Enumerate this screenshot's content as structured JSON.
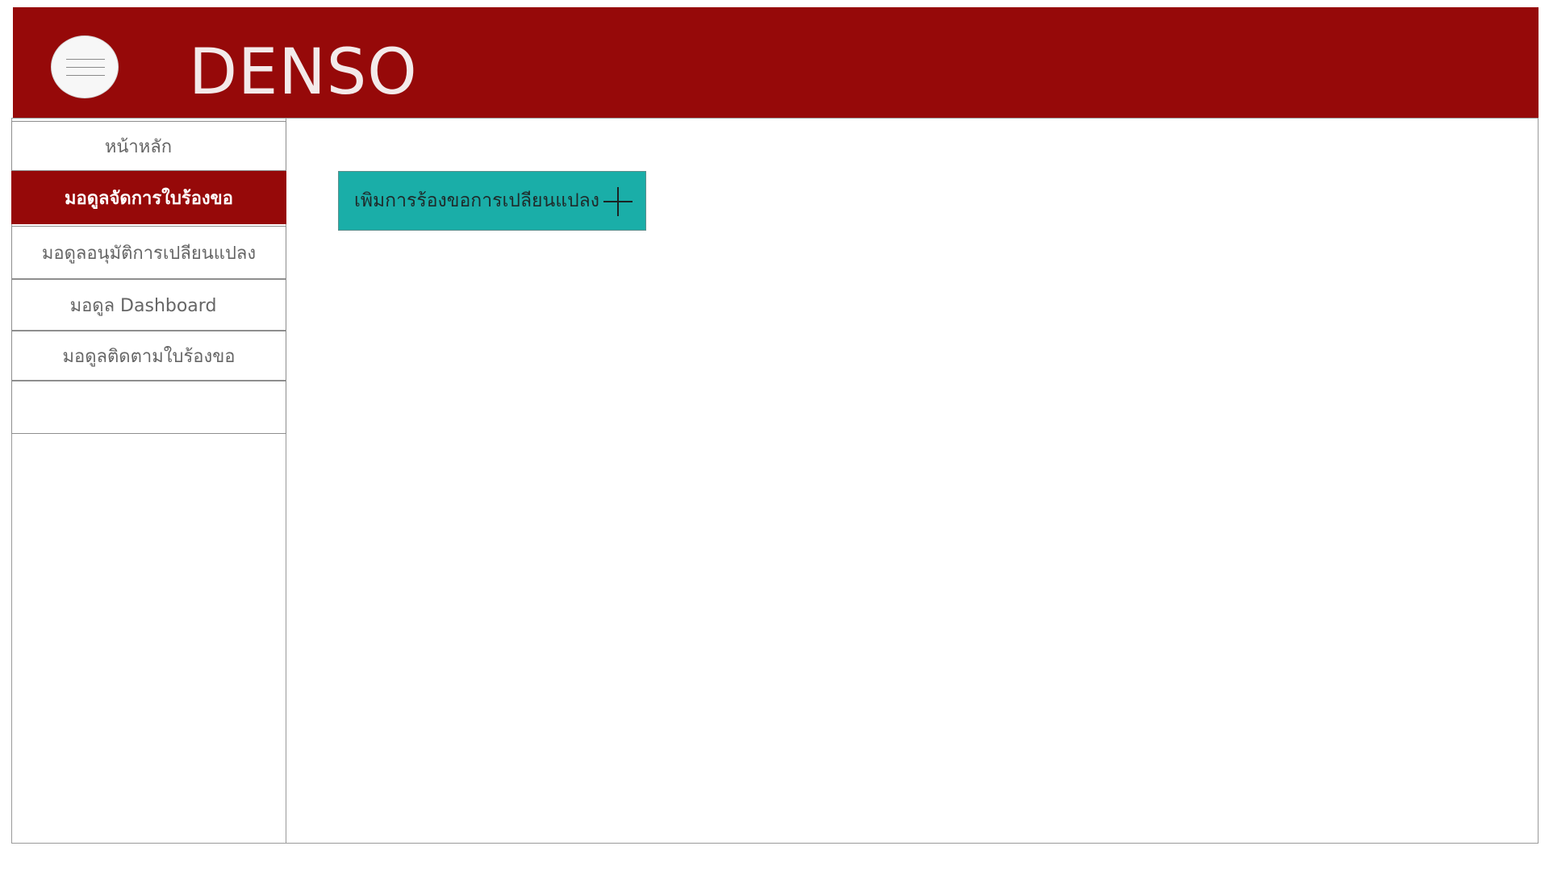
{
  "header": {
    "brand": "DENSO",
    "menu_icon": "hamburger-menu-icon",
    "background_color": "#960909"
  },
  "sidebar": {
    "items": [
      {
        "label": "หน้าหลัก",
        "active": false
      },
      {
        "label": "มอดูลจัดการใบร้องขอ",
        "active": true
      },
      {
        "label": "มอดูลอนุมัติการเปลียนแปลง",
        "active": false
      },
      {
        "label": "มอดูล Dashboard",
        "active": false
      },
      {
        "label": "มอดูลติดตามใบร้องขอ",
        "active": false
      },
      {
        "label": "",
        "active": false
      }
    ],
    "active_color": "#960909"
  },
  "main": {
    "add_button": {
      "label": "เพิมการร้องขอการเปลียนแปลง",
      "icon": "plus-icon",
      "background_color": "#1aaea8"
    }
  }
}
